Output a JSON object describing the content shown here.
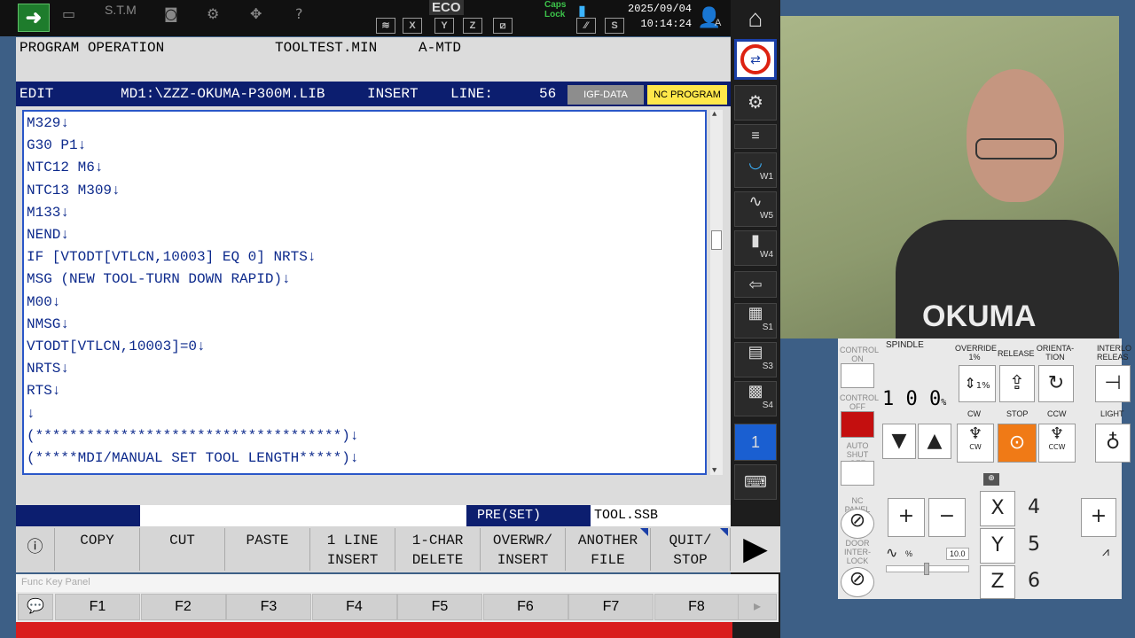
{
  "topbar": {
    "stm": "S.T.M",
    "eco": "ECO",
    "caps": "Caps Lock",
    "date": "2025/09/04",
    "time": "10:14:24",
    "user_letter": "A"
  },
  "header": {
    "mode": "PROGRAM OPERATION",
    "file": "TOOLTEST.MIN",
    "sys": "A-MTD"
  },
  "editbar": {
    "mode": "EDIT",
    "path": "MD1:\\ZZZ-OKUMA-P300M.LIB",
    "insert": "INSERT",
    "line_label": "LINE:",
    "line_num": "56",
    "tab1": "IGF-DATA",
    "tab2": "NC PROGRAM"
  },
  "code": {
    "lines": [
      "M329↓",
      "G30 P1↓",
      "NTC12 M6↓",
      "NTC13 M309↓",
      "M133↓",
      "NEND↓",
      "IF [VTODT[VTLCN,10003] EQ 0] NRTS↓",
      "MSG (NEW TOOL-TURN DOWN RAPID)↓",
      "M00↓",
      "NMSG↓",
      "VTODT[VTLCN,10003]=0↓",
      "NRTS↓",
      "RTS↓",
      "↓",
      "(************************************)↓",
      "(*****MDI/MANUAL SET TOOL LENGTH*****)↓"
    ]
  },
  "status": {
    "preset": "PRE(SET)",
    "file": "TOOL.SSB"
  },
  "fkeys": [
    {
      "l1": "COPY",
      "l2": ""
    },
    {
      "l1": "CUT",
      "l2": ""
    },
    {
      "l1": "PASTE",
      "l2": ""
    },
    {
      "l1": "1 LINE",
      "l2": "INSERT"
    },
    {
      "l1": "1-CHAR",
      "l2": "DELETE"
    },
    {
      "l1": "OVERWR/",
      "l2": "INSERT"
    },
    {
      "l1": "ANOTHER",
      "l2": "FILE"
    },
    {
      "l1": "QUIT/",
      "l2": "STOP"
    }
  ],
  "fkpanel": {
    "title": "Func Key Panel",
    "keys": [
      "F1",
      "F2",
      "F3",
      "F4",
      "F5",
      "F6",
      "F7",
      "F8"
    ]
  },
  "sidebar": {
    "w1": "W1",
    "w5": "W5",
    "w4": "W4",
    "s1": "S1",
    "s3": "S3",
    "s4": "S4",
    "page": "1"
  },
  "panel": {
    "control_on": "CONTROL ON",
    "control_off": "CONTROL OFF",
    "auto_shutoff": "AUTO SHUT OFF",
    "nc_panel": "NC PANEL",
    "door_interlock": "DOOR INTER-LOCK",
    "spindle": "SPINDLE",
    "override": "OVERRIDE 1%",
    "release": "RELEASE",
    "orientation": "ORIENTA-TION",
    "interlock": "INTERLO RELEAS",
    "override_digits": [
      "1",
      "0",
      "0"
    ],
    "pct": "%",
    "cw": "CW",
    "stop": "STOP",
    "ccw": "CCW",
    "light": "LIGHT",
    "one_pct": "1%",
    "feed_value": "10.0",
    "plus": "+",
    "minus": "−",
    "x": "X",
    "y": "Y",
    "z": "Z",
    "n4": "4",
    "n5": "5",
    "n6": "6",
    "cw_small": "CW",
    "ccw_small": "CCW"
  },
  "camera": {
    "logo": "OKUMA"
  }
}
